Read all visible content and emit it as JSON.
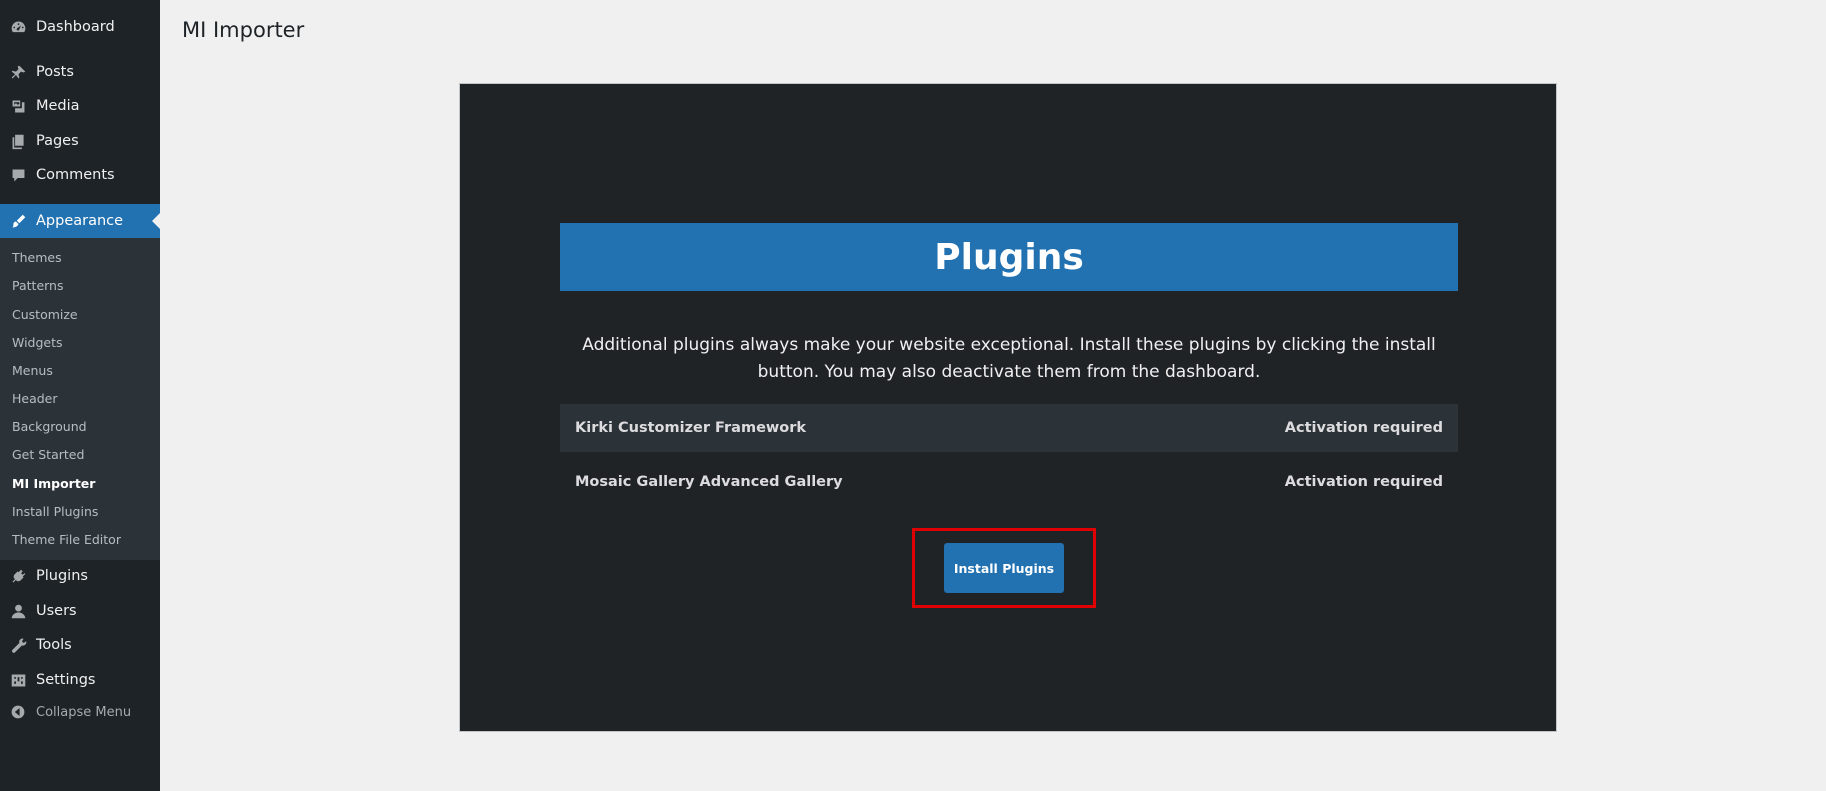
{
  "sidebar": {
    "top_items": [
      {
        "label": "Dashboard",
        "icon": "dashboard-icon"
      },
      {
        "label": "Posts",
        "icon": "pushpin-icon"
      },
      {
        "label": "Media",
        "icon": "media-icon"
      },
      {
        "label": "Pages",
        "icon": "pages-icon"
      },
      {
        "label": "Comments",
        "icon": "comments-icon"
      },
      {
        "label": "Appearance",
        "icon": "paintbrush-icon",
        "current": true
      }
    ],
    "submenu": [
      "Themes",
      "Patterns",
      "Customize",
      "Widgets",
      "Menus",
      "Header",
      "Background",
      "Get Started",
      "MI Importer",
      "Install Plugins",
      "Theme File Editor"
    ],
    "submenu_active": "MI Importer",
    "bottom_items": [
      {
        "label": "Plugins",
        "icon": "plugin-icon"
      },
      {
        "label": "Users",
        "icon": "users-icon"
      },
      {
        "label": "Tools",
        "icon": "wrench-icon"
      },
      {
        "label": "Settings",
        "icon": "settings-icon"
      }
    ],
    "collapse_label": "Collapse Menu"
  },
  "page": {
    "title": "MI Importer"
  },
  "panel": {
    "heading": "Plugins",
    "description": "Additional plugins always make your website exceptional. Install these plugins by clicking the install button. You may also deactivate them from the dashboard.",
    "plugins": [
      {
        "name": "Kirki Customizer Framework",
        "status": "Activation required"
      },
      {
        "name": "Mosaic Gallery Advanced Gallery",
        "status": "Activation required"
      }
    ],
    "install_button": "Install Plugins"
  },
  "colors": {
    "sidebar_bg": "#1d2327",
    "submenu_bg": "#2c3338",
    "accent": "#2271b1",
    "panel_bg": "#202326",
    "highlight_border": "#e00000"
  }
}
